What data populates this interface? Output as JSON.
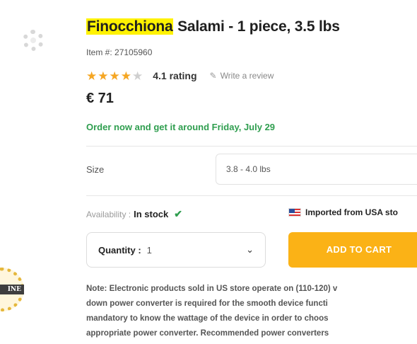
{
  "product": {
    "title_highlight": "Finocchiona",
    "title_rest": " Salami - 1 piece, 3.5 lbs",
    "item_number": "Item #: 27105960",
    "rating": 4.1,
    "rating_text": "4.1 rating",
    "review_link": "Write a review",
    "price": "€ 71",
    "delivery": "Order now and get it around Friday, July 29"
  },
  "options": {
    "size_label": "Size",
    "size_value": "3.8 - 4.0 lbs"
  },
  "availability": {
    "label": "Availability :",
    "value": "In stock",
    "imported": "Imported from USA sto"
  },
  "purchase": {
    "quantity_label": "Quantity :",
    "quantity_value": "1",
    "add_to_cart": "ADD TO CART"
  },
  "note": {
    "line1": "Note: Electronic products sold in US store operate on (110-120) v",
    "line2": "down power converter is required for the smooth device functi",
    "line3": "mandatory to know the wattage of the device in order to choos",
    "line4": "appropriate power converter. Recommended power converters"
  },
  "badge": {
    "text": "INE"
  },
  "icons": {
    "star": "star-icon",
    "pen": "pen-icon",
    "check": "check-icon",
    "flag": "usa-flag-icon",
    "chevron": "chevron-down-icon"
  }
}
